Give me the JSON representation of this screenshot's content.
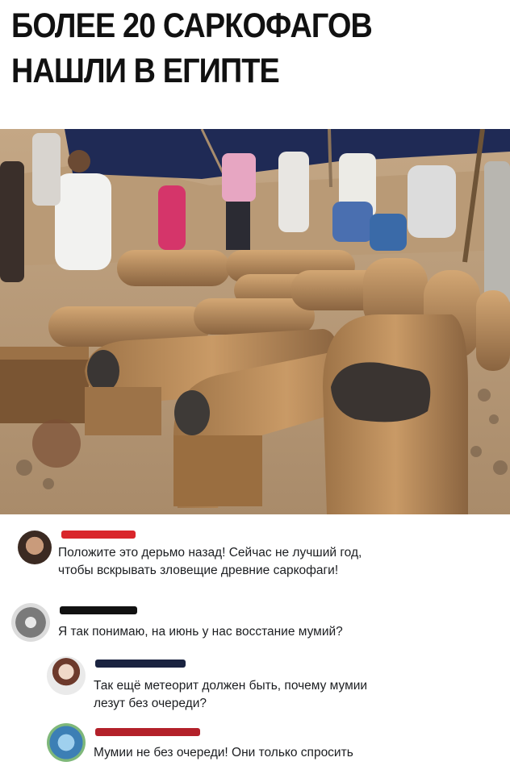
{
  "headline": {
    "line1": "БОЛЕЕ 20 САРКОФАГОВ",
    "line2": "НАШЛИ В ЕГИПТЕ"
  },
  "comments": [
    {
      "redacted_name": true,
      "name_bar_color": "#d9262b",
      "text_line1": "Положите это дерьмо назад! Сейчас не лучший год,",
      "text_line2": "чтобы вскрывать зловещие древние саркофаги!"
    },
    {
      "redacted_name": true,
      "name_bar_color": "#111111",
      "text_line1": "Я так понимаю, на июнь у нас восстание мумий?"
    },
    {
      "reply": true,
      "redacted_name": true,
      "name_bar_color": "#1a2340",
      "text_line1": "Так ещё метеорит должен быть, почему мумии",
      "text_line2": "лезут без очереди?"
    },
    {
      "reply": true,
      "redacted_name": true,
      "name_bar_color": "#b3212a",
      "text_line1": "Мумии не без очереди! Они только спросить"
    }
  ],
  "colors": {
    "sand": "#c9ab86",
    "tent": "#1f2a55",
    "coffin": "#b88958"
  }
}
